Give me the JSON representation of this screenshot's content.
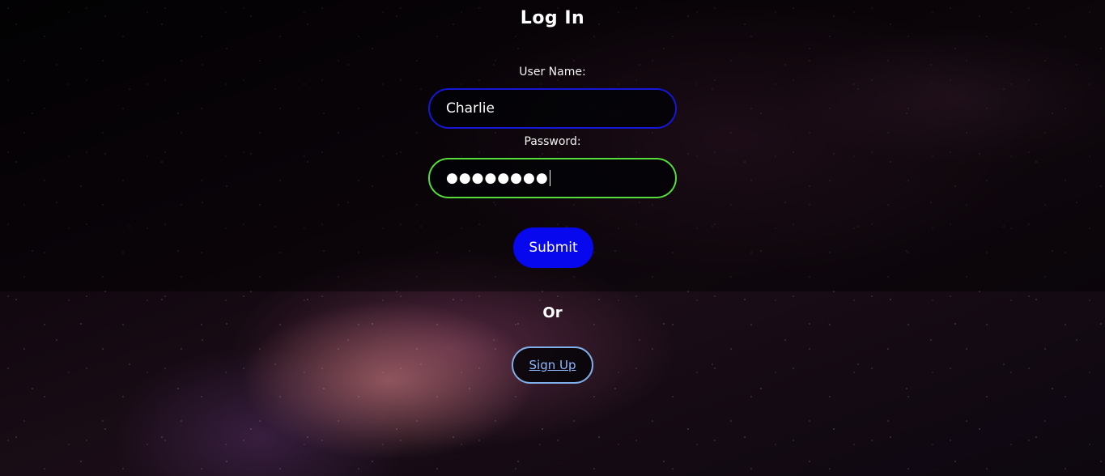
{
  "page": {
    "title": "Log In"
  },
  "form": {
    "username_label": "User Name:",
    "username_value": "Charlie",
    "password_label": "Password:",
    "password_mask": "●●●●●●●●",
    "submit_label": "Submit"
  },
  "alt": {
    "or_text": "Or",
    "signup_label": "Sign Up"
  },
  "colors": {
    "username_border": "#1616d8",
    "password_border": "#55dd3a",
    "submit_bg": "#0808ee",
    "signup_border": "#7faeea",
    "link": "#8fb8ff"
  },
  "icons": {
    "background": "starfield-background"
  }
}
